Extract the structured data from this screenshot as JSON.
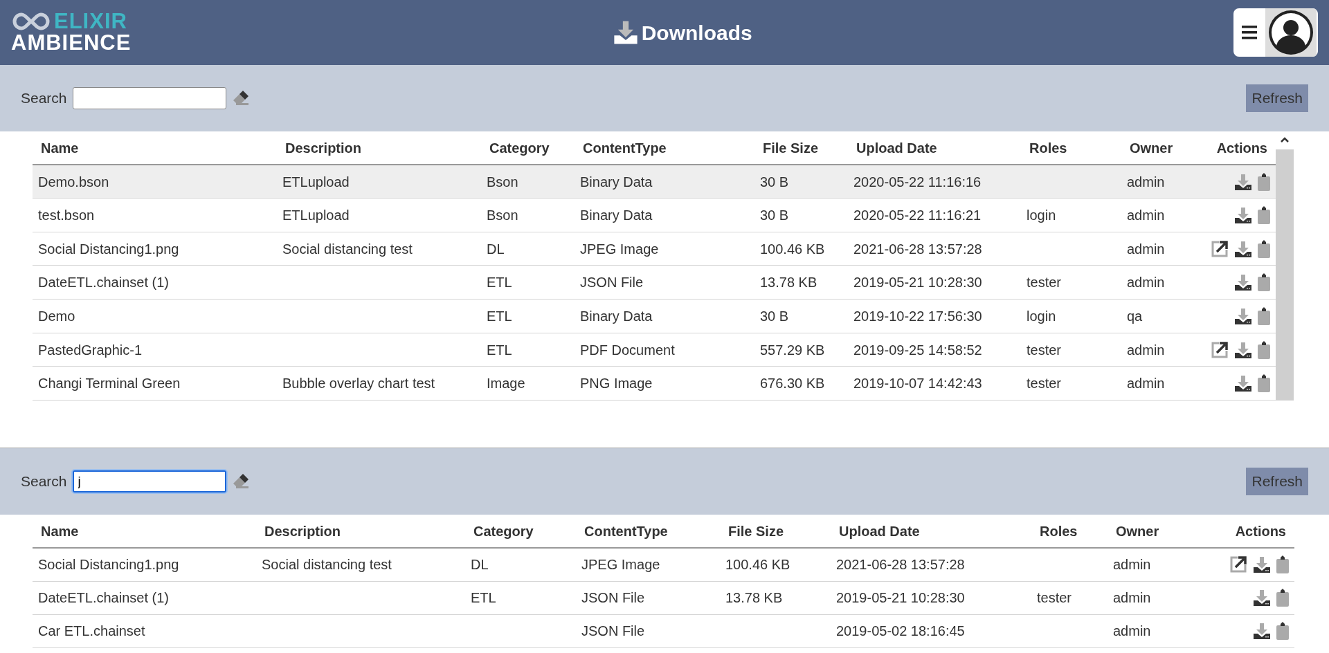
{
  "header": {
    "logo_top": "ELIXIR",
    "logo_bottom": "AMBIENCE",
    "title": "Downloads"
  },
  "panels": [
    {
      "search": {
        "label": "Search",
        "focused": false
      },
      "refresh": "Refresh",
      "scrollbar": true,
      "columns": [
        "Name",
        "Description",
        "Category",
        "ContentType",
        "File Size",
        "Upload Date",
        "Roles",
        "Owner",
        "Actions"
      ],
      "rows": [
        {
          "selected": true,
          "cells": [
            "Demo.bson",
            "ETLupload",
            "Bson",
            "Binary Data",
            "30 B",
            "2020-05-22 11:16:16",
            "",
            "admin"
          ],
          "open": false
        },
        {
          "selected": false,
          "cells": [
            "test.bson",
            "ETLupload",
            "Bson",
            "Binary Data",
            "30 B",
            "2020-05-22 11:16:21",
            "login",
            "admin"
          ],
          "open": false
        },
        {
          "selected": false,
          "cells": [
            "Social Distancing1.png",
            "Social distancing test",
            "DL",
            "JPEG Image",
            "100.46 KB",
            "2021-06-28 13:57:28",
            "",
            "admin"
          ],
          "open": true
        },
        {
          "selected": false,
          "cells": [
            "DateETL.chainset (1)",
            "",
            "ETL",
            "JSON File",
            "13.78 KB",
            "2019-05-21 10:28:30",
            "tester",
            "admin"
          ],
          "open": false
        },
        {
          "selected": false,
          "cells": [
            "Demo",
            "",
            "ETL",
            "Binary Data",
            "30 B",
            "2019-10-22 17:56:30",
            "login",
            "qa"
          ],
          "open": false
        },
        {
          "selected": false,
          "cells": [
            "PastedGraphic-1",
            "",
            "ETL",
            "PDF Document",
            "557.29 KB",
            "2019-09-25 14:58:52",
            "tester",
            "admin"
          ],
          "open": true
        },
        {
          "selected": false,
          "cells": [
            "Changi Terminal Green",
            "Bubble overlay chart test",
            "Image",
            "PNG Image",
            "676.30 KB",
            "2019-10-07 14:42:43",
            "tester",
            "admin"
          ],
          "open": false
        }
      ]
    },
    {
      "search": {
        "label": "Search",
        "value": "j",
        "focused": true
      },
      "refresh": "Refresh",
      "scrollbar": false,
      "columns": [
        "Name",
        "Description",
        "Category",
        "ContentType",
        "File Size",
        "Upload Date",
        "Roles",
        "Owner",
        "Actions"
      ],
      "rows": [
        {
          "selected": false,
          "cells": [
            "Social Distancing1.png",
            "Social distancing test",
            "DL",
            "JPEG Image",
            "100.46 KB",
            "2021-06-28 13:57:28",
            "",
            "admin"
          ],
          "open": true
        },
        {
          "selected": false,
          "cells": [
            "DateETL.chainset (1)",
            "",
            "ETL",
            "JSON File",
            "13.78 KB",
            "2019-05-21 10:28:30",
            "tester",
            "admin"
          ],
          "open": false
        },
        {
          "selected": false,
          "cells": [
            "Car ETL.chainset",
            "",
            "",
            "JSON File",
            "",
            "2019-05-02 18:16:45",
            "",
            "admin"
          ],
          "open": false
        }
      ]
    }
  ]
}
